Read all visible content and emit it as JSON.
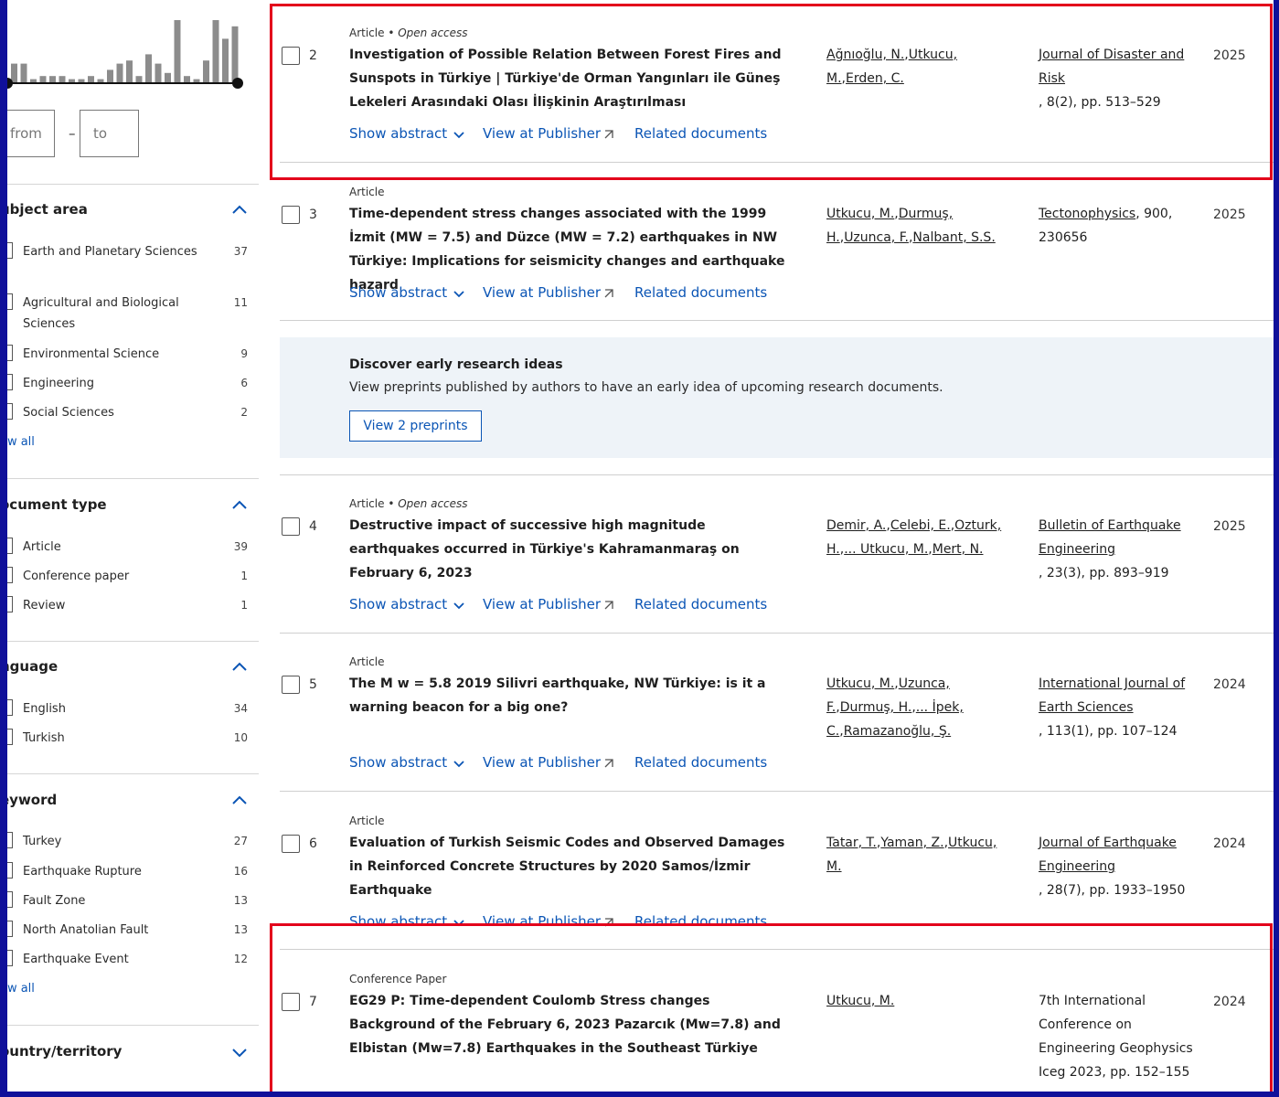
{
  "filters": {
    "year_range": {
      "from_placeholder": "from",
      "to_placeholder": "to",
      "separator": "–"
    },
    "histogram_bar_levels": [
      0.3,
      0.3,
      0.05,
      0.1,
      0.1,
      0.1,
      0.05,
      0.05,
      0.1,
      0.05,
      0.2,
      0.3,
      0.35,
      0.1,
      0.45,
      0.3,
      0.15,
      1.0,
      0.1,
      0.05,
      0.35,
      1.0,
      0.7,
      0.9
    ],
    "subject_area": {
      "title": "ubject area",
      "items": [
        {
          "label": "Earth and Planetary Sciences",
          "count": "37"
        },
        {
          "label": "Agricultural and Biological Sciences",
          "count": "11"
        },
        {
          "label": "Environmental Science",
          "count": "9"
        },
        {
          "label": "Engineering",
          "count": "6"
        },
        {
          "label": "Social Sciences",
          "count": "2"
        }
      ],
      "show_all": "ow all"
    },
    "document_type": {
      "title": "ocument type",
      "items": [
        {
          "label": "Article",
          "count": "39"
        },
        {
          "label": "Conference paper",
          "count": "1"
        },
        {
          "label": "Review",
          "count": "1"
        }
      ]
    },
    "language": {
      "title": "nguage",
      "items": [
        {
          "label": "English",
          "count": "34"
        },
        {
          "label": "Turkish",
          "count": "10"
        }
      ]
    },
    "keyword": {
      "title": "eyword",
      "items": [
        {
          "label": "Turkey",
          "count": "27"
        },
        {
          "label": "Earthquake Rupture",
          "count": "16"
        },
        {
          "label": "Fault Zone",
          "count": "13"
        },
        {
          "label": "North Anatolian Fault",
          "count": "13"
        },
        {
          "label": "Earthquake Event",
          "count": "12"
        }
      ],
      "show_all": "ow all"
    },
    "country": {
      "title": "ountry/territory"
    }
  },
  "actions": {
    "show_abstract": "Show abstract",
    "view_publisher": "View at Publisher",
    "related": "Related documents"
  },
  "results": [
    {
      "num": "2",
      "type": "Article",
      "access": "Open access",
      "title": "Investigation of Possible Relation Between Forest Fires and Sunspots in Türkiye | Türkiye'de Orman Yangınları ile Güneş Lekeleri Arasındaki Olası İlişkinin Araştırılması",
      "authors": [
        "Ağnıoğlu, N.",
        "Utkucu, M.",
        "Erden, C."
      ],
      "source_link": "Journal of Disaster and Risk",
      "source_detail": ", 8(2), pp. 513–529",
      "year": "2025"
    },
    {
      "num": "3",
      "type": "Article",
      "access": "",
      "title": "Time-dependent stress changes associated with the 1999 İzmit (MW = 7.5) and Düzce (MW = 7.2) earthquakes in NW Türkiye: Implications for seismicity changes and earthquake hazard",
      "authors": [
        "Utkucu, M.",
        "Durmuş, H.",
        "Uzunca, F.",
        "Nalbant, S.S."
      ],
      "source_link": "Tectonophysics",
      "source_detail": ", 900, 230656",
      "year": "2025"
    },
    {
      "num": "4",
      "type": "Article",
      "access": "Open access",
      "title": "Destructive impact of successive high magnitude earthquakes occurred in Türkiye's Kahramanmaraş on February 6, 2023",
      "authors": [
        "Demir, A.",
        "Celebi, E.",
        "Ozturk, H.",
        "... Utkucu, M.",
        "Mert, N."
      ],
      "source_link": "Bulletin of Earthquake Engineering",
      "source_detail": ", 23(3), pp. 893–919",
      "year": "2025"
    },
    {
      "num": "5",
      "type": "Article",
      "access": "",
      "title": "The M w = 5.8 2019 Silivri earthquake, NW Türkiye: is it a warning beacon for a big one?",
      "authors": [
        "Utkucu, M.",
        "Uzunca, F.",
        "Durmuş, H.",
        "... İpek, C.",
        "Ramazanoğlu, Ş."
      ],
      "source_link": "International Journal of Earth Sciences",
      "source_detail": ", 113(1), pp. 107–124",
      "year": "2024"
    },
    {
      "num": "6",
      "type": "Article",
      "access": "",
      "title": "Evaluation of Turkish Seismic Codes and Observed Damages in Reinforced Concrete Structures by 2020 Samos/İzmir Earthquake",
      "authors": [
        "Tatar, T.",
        "Yaman, Z.",
        "Utkucu, M."
      ],
      "source_link": "Journal of Earthquake Engineering",
      "source_detail": ", 28(7), pp. 1933–1950",
      "year": "2024"
    },
    {
      "num": "7",
      "type": "Conference Paper",
      "access": "",
      "title": "EG29 P: Time-dependent Coulomb Stress changes Background of the February 6, 2023 Pazarcık (Mw=7.8) and Elbistan (Mw=7.8) Earthquakes in the Southeast Türkiye",
      "authors": [
        "Utkucu, M."
      ],
      "source_link": "",
      "source_detail": "7th International Conference on Engineering Geophysics Iceg 2023, pp. 152–155",
      "year": "2024"
    }
  ],
  "promo": {
    "title": "Discover early research ideas",
    "text": "View preprints published by authors to have an early idea of upcoming research documents.",
    "button": "View 2 preprints"
  },
  "colors": {
    "link": "#0b55b5",
    "highlight": "#e3001b",
    "outer_bg": "#10109a",
    "promo_bg": "#eef3f8"
  }
}
